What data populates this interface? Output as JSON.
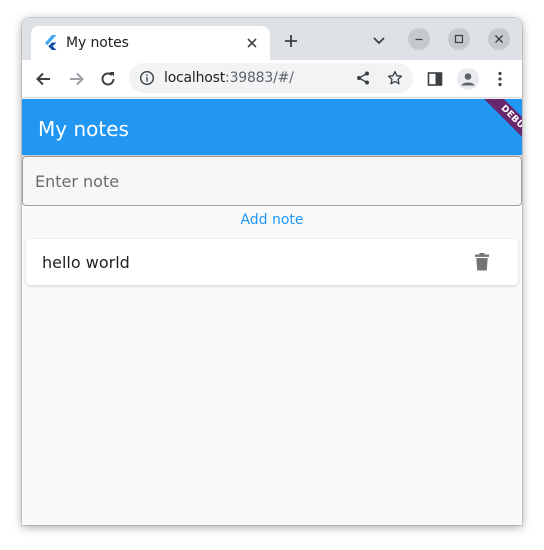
{
  "browser": {
    "tab": {
      "title": "My notes",
      "favicon": "flutter-icon"
    },
    "address": {
      "host": "localhost",
      "rest": ":39883/#/"
    }
  },
  "app": {
    "title": "My notes",
    "debug_banner": "DEBUG",
    "input": {
      "placeholder": "Enter note",
      "value": ""
    },
    "add_button": "Add note",
    "notes": [
      {
        "text": "hello world"
      }
    ]
  },
  "colors": {
    "primary": "#2196f3",
    "debug": "#800040"
  }
}
